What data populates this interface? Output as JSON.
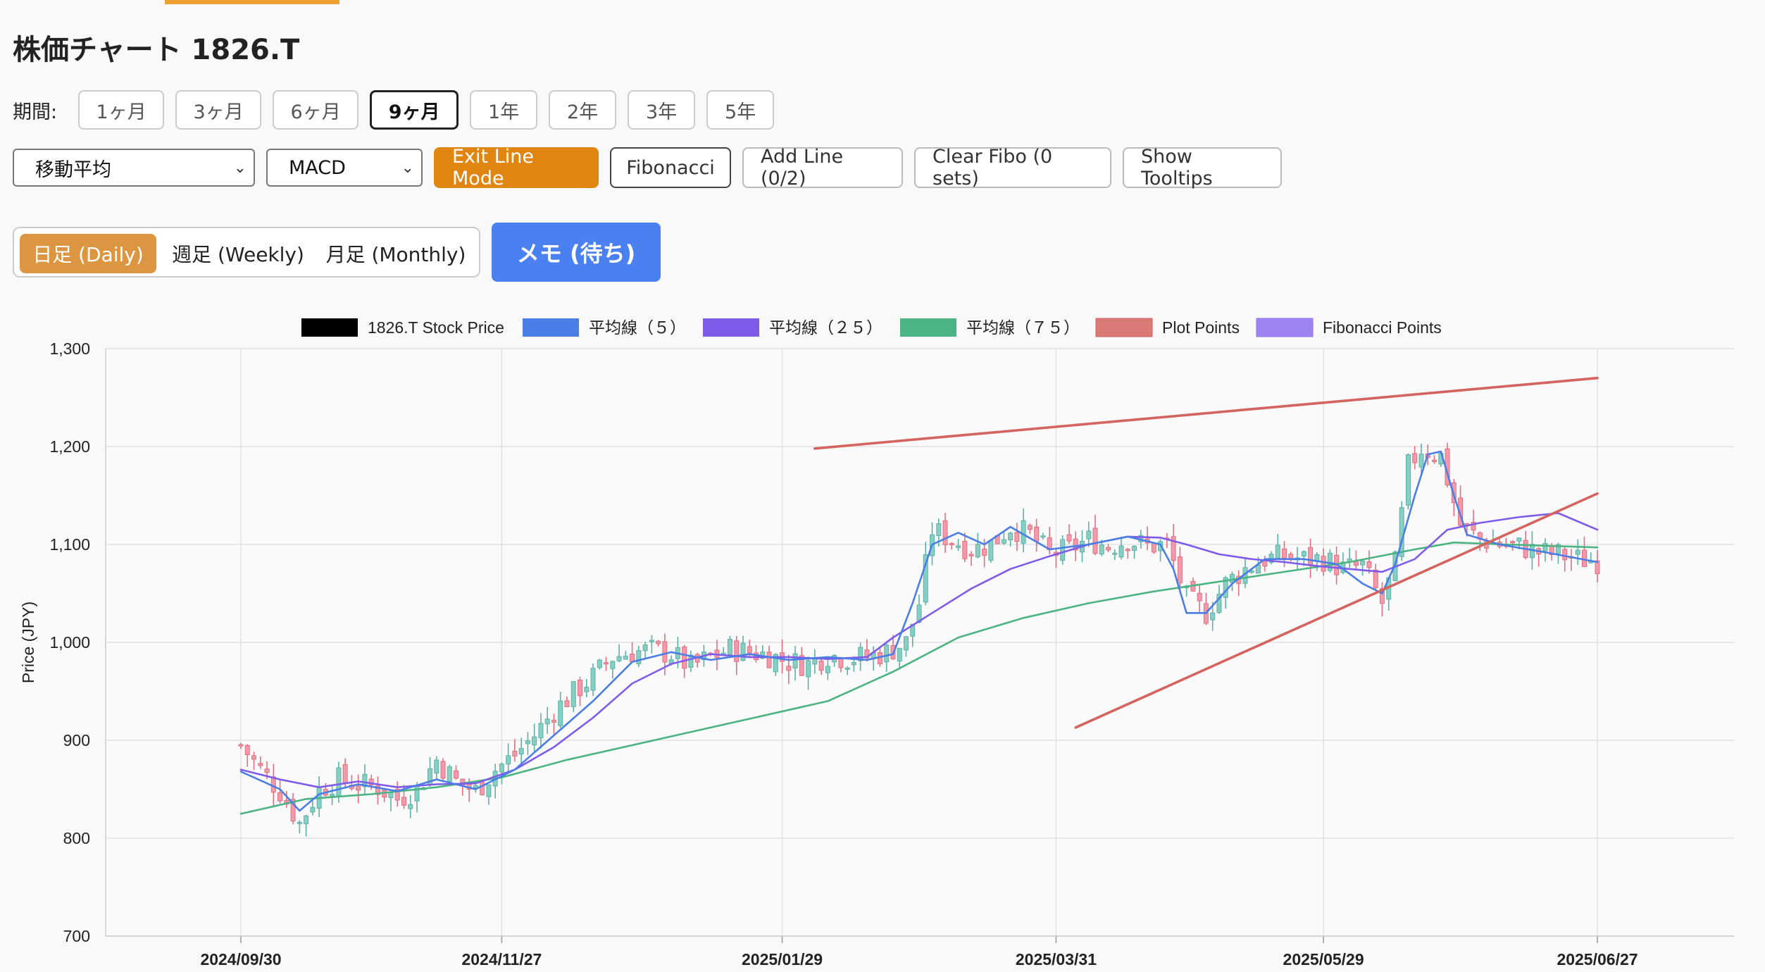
{
  "page": {
    "title": "株価チャート 1826.T"
  },
  "period": {
    "label": "期間:",
    "buttons": [
      "1ヶ月",
      "3ヶ月",
      "6ヶ月",
      "9ヶ月",
      "1年",
      "2年",
      "3年",
      "5年"
    ],
    "active": "9ヶ月"
  },
  "controls": {
    "indicator_select": "移動平均",
    "oscillator_select": "MACD",
    "exit_line_mode": "Exit Line Mode",
    "fibonacci": "Fibonacci",
    "add_line": "Add Line (0/2)",
    "clear_fibo": "Clear Fibo (0 sets)",
    "show_tooltips": "Show Tooltips"
  },
  "timeframe": {
    "options": [
      "日足 (Daily)",
      "週足 (Weekly)",
      "月足 (Monthly)"
    ],
    "active": "日足 (Daily)"
  },
  "memo_button": "メモ (待ち)",
  "colors": {
    "accent_orange": "#e08510",
    "memo_blue": "#4a80f0",
    "candle_up": "#86cfc4",
    "candle_down": "#f29aab",
    "ma5": "#4a7ee6",
    "ma25": "#7f5bea",
    "ma75": "#4cb382",
    "plot_points": "#d4645f",
    "fibonacci": "#8e6ff0"
  },
  "chart_data": {
    "type": "candlestick",
    "ylabel": "Price (JPY)",
    "ylim": [
      700,
      1300
    ],
    "yticks": [
      "1,300",
      "1,200",
      "1,100",
      "1,000",
      "900",
      "800",
      "700"
    ],
    "xticks": [
      "2024/09/30",
      "2024/11/27",
      "2025/01/29",
      "2025/03/31",
      "2025/05/29",
      "2025/06/27"
    ],
    "grid": true,
    "legend_position": "top",
    "legend": [
      {
        "name": "1826.T Stock Price",
        "color": "#000000"
      },
      {
        "name": "平均線（５）",
        "color": "#4a7ee6"
      },
      {
        "name": "平均線（２５）",
        "color": "#7f5bea"
      },
      {
        "name": "平均線（７５）",
        "color": "#4cb382"
      },
      {
        "name": "Plot Points",
        "color": "#d4645f"
      },
      {
        "name": "Fibonacci Points",
        "color": "#8e6ff0"
      }
    ],
    "close_series": [
      [
        0,
        895
      ],
      [
        3,
        870
      ],
      [
        6,
        848
      ],
      [
        9,
        815
      ],
      [
        12,
        850
      ],
      [
        15,
        860
      ],
      [
        18,
        855
      ],
      [
        21,
        852
      ],
      [
        24,
        840
      ],
      [
        27,
        850
      ],
      [
        30,
        880
      ],
      [
        33,
        858
      ],
      [
        36,
        848
      ],
      [
        39,
        870
      ],
      [
        42,
        885
      ],
      [
        45,
        905
      ],
      [
        48,
        930
      ],
      [
        51,
        948
      ],
      [
        54,
        965
      ],
      [
        57,
        985
      ],
      [
        60,
        990
      ],
      [
        63,
        992
      ],
      [
        66,
        988
      ],
      [
        69,
        975
      ],
      [
        72,
        985
      ],
      [
        75,
        993
      ],
      [
        78,
        990
      ],
      [
        81,
        987
      ],
      [
        84,
        980
      ],
      [
        87,
        978
      ],
      [
        90,
        987
      ],
      [
        93,
        984
      ],
      [
        96,
        985
      ],
      [
        99,
        990
      ],
      [
        102,
        1000
      ],
      [
        104,
        1040
      ],
      [
        106,
        1115
      ],
      [
        109,
        1105
      ],
      [
        112,
        1095
      ],
      [
        115,
        1100
      ],
      [
        118,
        1118
      ],
      [
        121,
        1110
      ],
      [
        124,
        1090
      ],
      [
        127,
        1095
      ],
      [
        130,
        1105
      ],
      [
        133,
        1098
      ],
      [
        136,
        1105
      ],
      [
        139,
        1098
      ],
      [
        142,
        1100
      ],
      [
        145,
        1045
      ],
      [
        148,
        1030
      ],
      [
        151,
        1060
      ],
      [
        154,
        1075
      ],
      [
        157,
        1085
      ],
      [
        160,
        1088
      ],
      [
        163,
        1085
      ],
      [
        166,
        1085
      ],
      [
        169,
        1075
      ],
      [
        172,
        1078
      ],
      [
        175,
        1040
      ],
      [
        177,
        1080
      ],
      [
        179,
        1180
      ],
      [
        181,
        1198
      ],
      [
        184,
        1190
      ],
      [
        187,
        1120
      ],
      [
        190,
        1105
      ],
      [
        193,
        1100
      ],
      [
        196,
        1098
      ],
      [
        199,
        1092
      ],
      [
        202,
        1090
      ],
      [
        205,
        1085
      ],
      [
        208,
        1083
      ]
    ],
    "ma5": [
      [
        0,
        868
      ],
      [
        6,
        850
      ],
      [
        9,
        828
      ],
      [
        12,
        845
      ],
      [
        18,
        855
      ],
      [
        24,
        848
      ],
      [
        30,
        860
      ],
      [
        36,
        850
      ],
      [
        42,
        870
      ],
      [
        48,
        905
      ],
      [
        54,
        940
      ],
      [
        60,
        980
      ],
      [
        66,
        990
      ],
      [
        72,
        982
      ],
      [
        78,
        988
      ],
      [
        84,
        982
      ],
      [
        90,
        985
      ],
      [
        96,
        982
      ],
      [
        100,
        988
      ],
      [
        103,
        1040
      ],
      [
        106,
        1100
      ],
      [
        110,
        1112
      ],
      [
        114,
        1100
      ],
      [
        118,
        1118
      ],
      [
        124,
        1095
      ],
      [
        130,
        1100
      ],
      [
        136,
        1108
      ],
      [
        141,
        1100
      ],
      [
        143,
        1075
      ],
      [
        145,
        1030
      ],
      [
        148,
        1030
      ],
      [
        152,
        1060
      ],
      [
        157,
        1085
      ],
      [
        163,
        1085
      ],
      [
        168,
        1080
      ],
      [
        172,
        1060
      ],
      [
        175,
        1050
      ],
      [
        177,
        1080
      ],
      [
        180,
        1150
      ],
      [
        182,
        1192
      ],
      [
        184,
        1195
      ],
      [
        186,
        1150
      ],
      [
        188,
        1110
      ],
      [
        193,
        1100
      ],
      [
        200,
        1092
      ],
      [
        208,
        1082
      ]
    ],
    "ma25": [
      [
        0,
        870
      ],
      [
        6,
        860
      ],
      [
        12,
        852
      ],
      [
        18,
        858
      ],
      [
        24,
        852
      ],
      [
        30,
        855
      ],
      [
        36,
        856
      ],
      [
        42,
        870
      ],
      [
        48,
        893
      ],
      [
        54,
        923
      ],
      [
        60,
        958
      ],
      [
        66,
        978
      ],
      [
        72,
        988
      ],
      [
        78,
        985
      ],
      [
        84,
        985
      ],
      [
        90,
        983
      ],
      [
        96,
        985
      ],
      [
        100,
        1005
      ],
      [
        106,
        1030
      ],
      [
        112,
        1055
      ],
      [
        118,
        1075
      ],
      [
        124,
        1088
      ],
      [
        130,
        1100
      ],
      [
        136,
        1108
      ],
      [
        141,
        1107
      ],
      [
        145,
        1100
      ],
      [
        150,
        1090
      ],
      [
        155,
        1085
      ],
      [
        160,
        1082
      ],
      [
        165,
        1078
      ],
      [
        170,
        1075
      ],
      [
        175,
        1072
      ],
      [
        180,
        1085
      ],
      [
        185,
        1115
      ],
      [
        190,
        1122
      ],
      [
        196,
        1128
      ],
      [
        202,
        1132
      ],
      [
        208,
        1115
      ]
    ],
    "ma75": [
      [
        0,
        825
      ],
      [
        10,
        840
      ],
      [
        20,
        845
      ],
      [
        30,
        852
      ],
      [
        40,
        862
      ],
      [
        50,
        880
      ],
      [
        60,
        895
      ],
      [
        70,
        910
      ],
      [
        80,
        925
      ],
      [
        90,
        940
      ],
      [
        100,
        970
      ],
      [
        110,
        1005
      ],
      [
        120,
        1025
      ],
      [
        130,
        1040
      ],
      [
        140,
        1052
      ],
      [
        150,
        1062
      ],
      [
        160,
        1072
      ],
      [
        170,
        1082
      ],
      [
        180,
        1095
      ],
      [
        186,
        1102
      ],
      [
        194,
        1100
      ],
      [
        208,
        1097
      ]
    ],
    "plot_point_lines": [
      {
        "from": [
          "2025/02/07",
          1198
        ],
        "to": [
          "2025/06/27",
          1270
        ]
      },
      {
        "from": [
          "2025/04/04",
          913
        ],
        "to": [
          "2025/06/27",
          1152
        ]
      }
    ]
  }
}
